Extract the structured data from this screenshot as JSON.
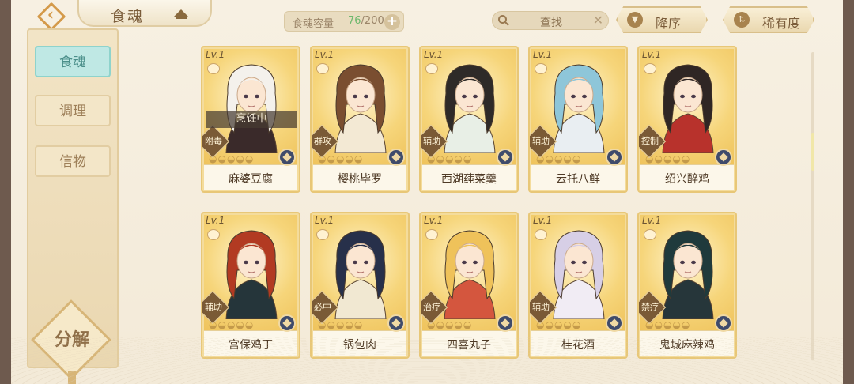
{
  "header": {
    "title": "食魂",
    "capacity_label": "食魂容量",
    "capacity_current": "76",
    "capacity_total": "/200",
    "plus": "+",
    "search_text": "查找",
    "clear": "✕",
    "sort_desc_label": "降序",
    "sort_rarity_label": "稀有度"
  },
  "sidebar": {
    "items": [
      {
        "label": "食魂"
      },
      {
        "label": "调理"
      },
      {
        "label": "信物"
      }
    ],
    "decompose_label": "分解"
  },
  "cards": [
    {
      "name": "麻婆豆腐",
      "level": "Lv.1",
      "role": "附毒",
      "status": "烹饪中",
      "hair": "#f4f1ec",
      "outfit": "#3a2a2a"
    },
    {
      "name": "樱桃毕罗",
      "level": "Lv.1",
      "role": "群攻",
      "hair": "#7a4e30",
      "outfit": "#f3e9d4"
    },
    {
      "name": "西湖莼菜羹",
      "level": "Lv.1",
      "role": "辅助",
      "hair": "#2e2a28",
      "outfit": "#e8efe6"
    },
    {
      "name": "云托八鲜",
      "level": "Lv.1",
      "role": "辅助",
      "hair": "#8ec6d9",
      "outfit": "#e9eef2"
    },
    {
      "name": "绍兴醉鸡",
      "level": "Lv.1",
      "role": "控制",
      "hair": "#2f2624",
      "outfit": "#b8322c"
    },
    {
      "name": "宫保鸡丁",
      "level": "Lv.1",
      "role": "辅助",
      "hair": "#b23a22",
      "outfit": "#25353a"
    },
    {
      "name": "锅包肉",
      "level": "Lv.1",
      "role": "必中",
      "hair": "#27304a",
      "outfit": "#f1e8d2"
    },
    {
      "name": "四喜丸子",
      "level": "Lv.1",
      "role": "治疗",
      "hair": "#efc25a",
      "outfit": "#d4563e"
    },
    {
      "name": "桂花酒",
      "level": "Lv.1",
      "role": "辅助",
      "hair": "#d7cfe6",
      "outfit": "#f1ecf4"
    },
    {
      "name": "鬼城麻辣鸡",
      "level": "Lv.1",
      "role": "禁疗",
      "hair": "#1f3a3c",
      "outfit": "#26363a"
    }
  ],
  "stars": "◒◒◒◒◒",
  "rarity_badge": "",
  "icons": {
    "back": "back-arrow-icon",
    "hat": "chef-hat-icon",
    "search": "magnifier-icon",
    "element": "element-icon"
  }
}
